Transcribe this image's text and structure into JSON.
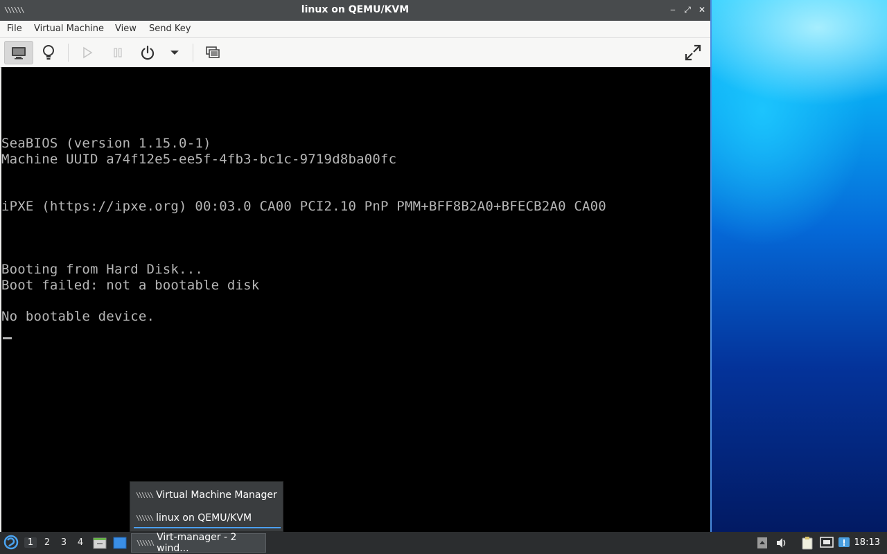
{
  "window": {
    "title": "linux on QEMU/KVM",
    "app_icon": "virt-manager-icon",
    "minimize": "‒",
    "maximize": "⤢",
    "close": "✕"
  },
  "menubar": {
    "items": [
      "File",
      "Virtual Machine",
      "View",
      "Send Key"
    ]
  },
  "toolbar": {
    "buttons": [
      "console-icon",
      "details-lightbulb-icon",
      "run-icon",
      "pause-icon",
      "power-icon",
      "dropdown-icon",
      "snapshot-icon",
      "fullscreen-icon"
    ]
  },
  "console": {
    "lines": [
      "SeaBIOS (version 1.15.0-1)",
      "Machine UUID a74f12e5-ee5f-4fb3-bc1c-9719d8ba00fc",
      "iPXE (https://ipxe.org) 00:03.0 CA00 PCI2.10 PnP PMM+BFF8B2A0+BFECB2A0 CA00",
      "Booting from Hard Disk...",
      "Boot failed: not a bootable disk",
      "No bootable device."
    ]
  },
  "popup": {
    "items": [
      "Virtual Machine Manager",
      "linux on QEMU/KVM"
    ],
    "selected": 1
  },
  "taskbar": {
    "workspaces": [
      "1",
      "2",
      "3",
      "4"
    ],
    "active_workspace": "1",
    "task_label": "Virt-manager - 2 wind...",
    "clock": "18:13"
  },
  "colors": {
    "titlebar": "#484b4d",
    "console_text": "#b6b6b6",
    "accent": "#4b9ff0",
    "taskbar": "#2b2d2f"
  }
}
